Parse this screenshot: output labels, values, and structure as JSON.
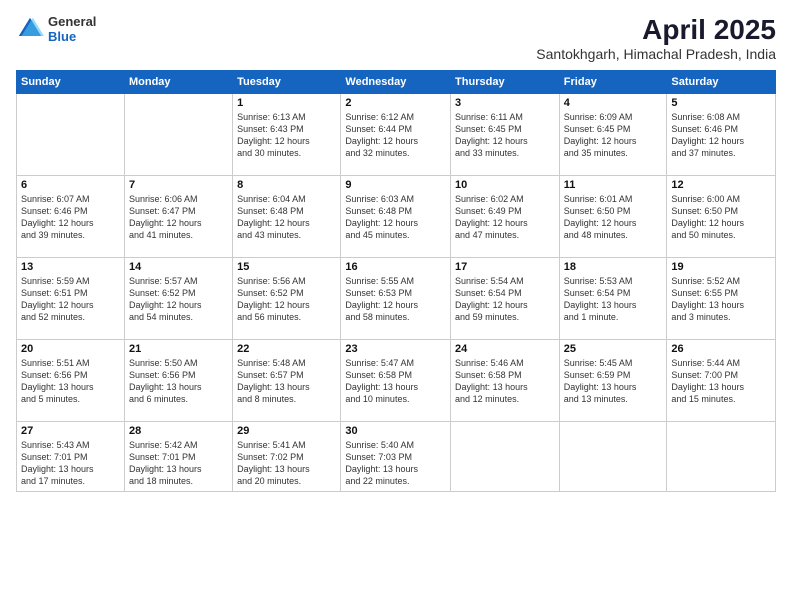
{
  "header": {
    "logo_general": "General",
    "logo_blue": "Blue",
    "title": "April 2025",
    "subtitle": "Santokhgarh, Himachal Pradesh, India"
  },
  "days_of_week": [
    "Sunday",
    "Monday",
    "Tuesday",
    "Wednesday",
    "Thursday",
    "Friday",
    "Saturday"
  ],
  "weeks": [
    [
      {
        "day": "",
        "info": ""
      },
      {
        "day": "",
        "info": ""
      },
      {
        "day": "1",
        "info": "Sunrise: 6:13 AM\nSunset: 6:43 PM\nDaylight: 12 hours\nand 30 minutes."
      },
      {
        "day": "2",
        "info": "Sunrise: 6:12 AM\nSunset: 6:44 PM\nDaylight: 12 hours\nand 32 minutes."
      },
      {
        "day": "3",
        "info": "Sunrise: 6:11 AM\nSunset: 6:45 PM\nDaylight: 12 hours\nand 33 minutes."
      },
      {
        "day": "4",
        "info": "Sunrise: 6:09 AM\nSunset: 6:45 PM\nDaylight: 12 hours\nand 35 minutes."
      },
      {
        "day": "5",
        "info": "Sunrise: 6:08 AM\nSunset: 6:46 PM\nDaylight: 12 hours\nand 37 minutes."
      }
    ],
    [
      {
        "day": "6",
        "info": "Sunrise: 6:07 AM\nSunset: 6:46 PM\nDaylight: 12 hours\nand 39 minutes."
      },
      {
        "day": "7",
        "info": "Sunrise: 6:06 AM\nSunset: 6:47 PM\nDaylight: 12 hours\nand 41 minutes."
      },
      {
        "day": "8",
        "info": "Sunrise: 6:04 AM\nSunset: 6:48 PM\nDaylight: 12 hours\nand 43 minutes."
      },
      {
        "day": "9",
        "info": "Sunrise: 6:03 AM\nSunset: 6:48 PM\nDaylight: 12 hours\nand 45 minutes."
      },
      {
        "day": "10",
        "info": "Sunrise: 6:02 AM\nSunset: 6:49 PM\nDaylight: 12 hours\nand 47 minutes."
      },
      {
        "day": "11",
        "info": "Sunrise: 6:01 AM\nSunset: 6:50 PM\nDaylight: 12 hours\nand 48 minutes."
      },
      {
        "day": "12",
        "info": "Sunrise: 6:00 AM\nSunset: 6:50 PM\nDaylight: 12 hours\nand 50 minutes."
      }
    ],
    [
      {
        "day": "13",
        "info": "Sunrise: 5:59 AM\nSunset: 6:51 PM\nDaylight: 12 hours\nand 52 minutes."
      },
      {
        "day": "14",
        "info": "Sunrise: 5:57 AM\nSunset: 6:52 PM\nDaylight: 12 hours\nand 54 minutes."
      },
      {
        "day": "15",
        "info": "Sunrise: 5:56 AM\nSunset: 6:52 PM\nDaylight: 12 hours\nand 56 minutes."
      },
      {
        "day": "16",
        "info": "Sunrise: 5:55 AM\nSunset: 6:53 PM\nDaylight: 12 hours\nand 58 minutes."
      },
      {
        "day": "17",
        "info": "Sunrise: 5:54 AM\nSunset: 6:54 PM\nDaylight: 12 hours\nand 59 minutes."
      },
      {
        "day": "18",
        "info": "Sunrise: 5:53 AM\nSunset: 6:54 PM\nDaylight: 13 hours\nand 1 minute."
      },
      {
        "day": "19",
        "info": "Sunrise: 5:52 AM\nSunset: 6:55 PM\nDaylight: 13 hours\nand 3 minutes."
      }
    ],
    [
      {
        "day": "20",
        "info": "Sunrise: 5:51 AM\nSunset: 6:56 PM\nDaylight: 13 hours\nand 5 minutes."
      },
      {
        "day": "21",
        "info": "Sunrise: 5:50 AM\nSunset: 6:56 PM\nDaylight: 13 hours\nand 6 minutes."
      },
      {
        "day": "22",
        "info": "Sunrise: 5:48 AM\nSunset: 6:57 PM\nDaylight: 13 hours\nand 8 minutes."
      },
      {
        "day": "23",
        "info": "Sunrise: 5:47 AM\nSunset: 6:58 PM\nDaylight: 13 hours\nand 10 minutes."
      },
      {
        "day": "24",
        "info": "Sunrise: 5:46 AM\nSunset: 6:58 PM\nDaylight: 13 hours\nand 12 minutes."
      },
      {
        "day": "25",
        "info": "Sunrise: 5:45 AM\nSunset: 6:59 PM\nDaylight: 13 hours\nand 13 minutes."
      },
      {
        "day": "26",
        "info": "Sunrise: 5:44 AM\nSunset: 7:00 PM\nDaylight: 13 hours\nand 15 minutes."
      }
    ],
    [
      {
        "day": "27",
        "info": "Sunrise: 5:43 AM\nSunset: 7:01 PM\nDaylight: 13 hours\nand 17 minutes."
      },
      {
        "day": "28",
        "info": "Sunrise: 5:42 AM\nSunset: 7:01 PM\nDaylight: 13 hours\nand 18 minutes."
      },
      {
        "day": "29",
        "info": "Sunrise: 5:41 AM\nSunset: 7:02 PM\nDaylight: 13 hours\nand 20 minutes."
      },
      {
        "day": "30",
        "info": "Sunrise: 5:40 AM\nSunset: 7:03 PM\nDaylight: 13 hours\nand 22 minutes."
      },
      {
        "day": "",
        "info": ""
      },
      {
        "day": "",
        "info": ""
      },
      {
        "day": "",
        "info": ""
      }
    ]
  ]
}
